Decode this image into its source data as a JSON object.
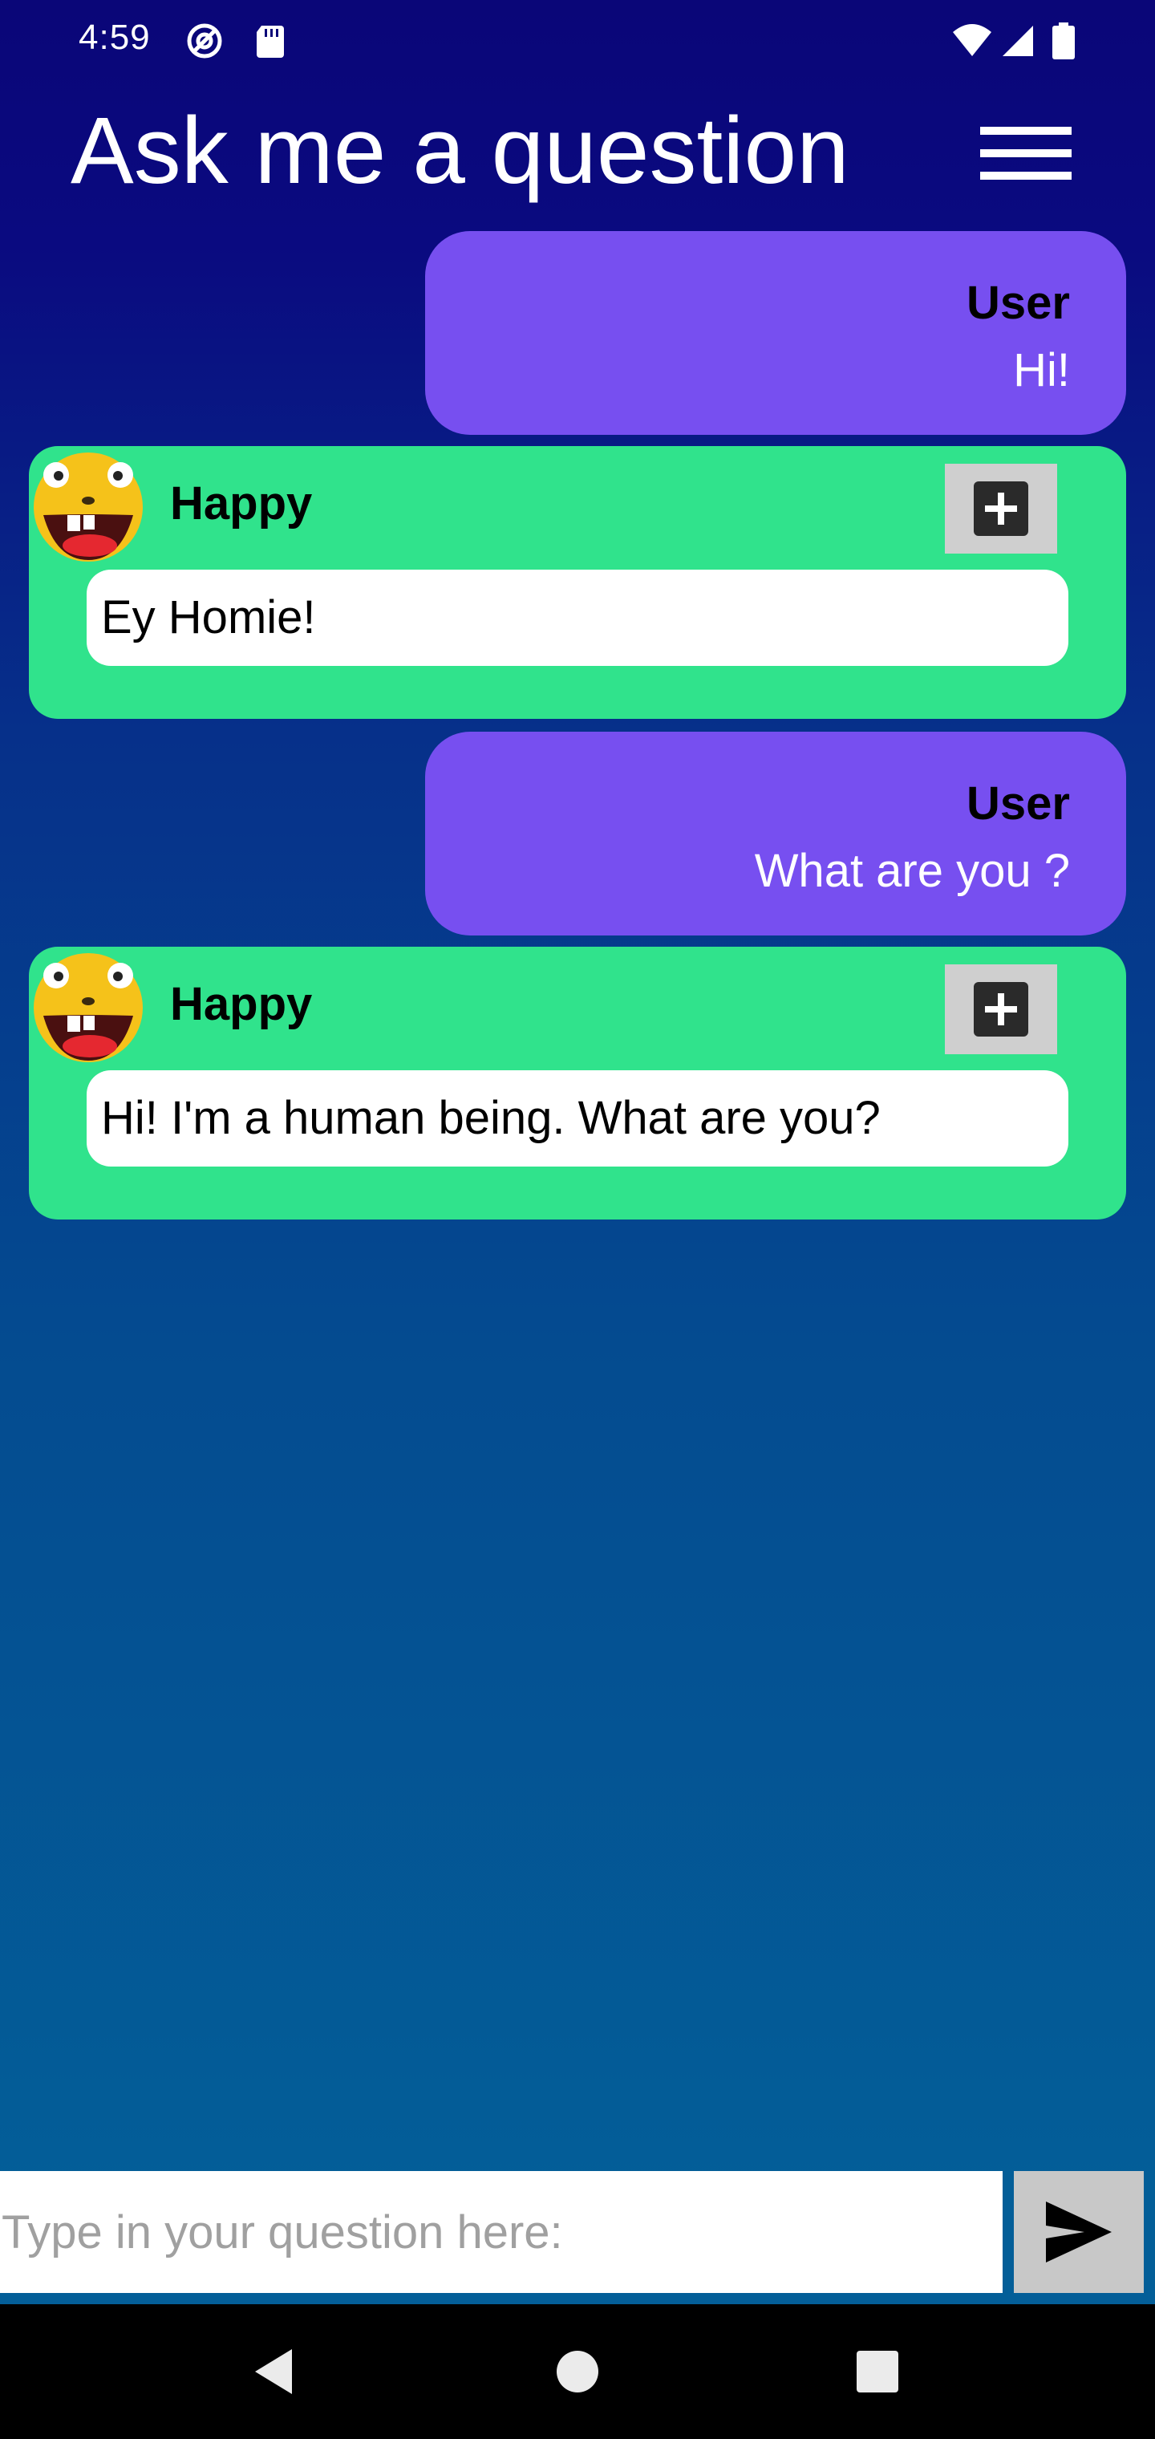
{
  "status_bar": {
    "time": "4:59",
    "icons": [
      "at-sign-icon",
      "sd-card-icon",
      "wifi-icon",
      "cellular-signal-icon",
      "battery-icon"
    ]
  },
  "header": {
    "title": "Ask me a question",
    "menu_icon": "hamburger-menu-icon"
  },
  "messages": [
    {
      "type": "user",
      "sender": "User",
      "text": "Hi!"
    },
    {
      "type": "bot",
      "sender": "Happy",
      "avatar": "happy-face-avatar",
      "action_icon": "add-box-icon",
      "text": "Ey Homie!"
    },
    {
      "type": "user",
      "sender": "User",
      "text": "What are you ?"
    },
    {
      "type": "bot",
      "sender": "Happy",
      "avatar": "happy-face-avatar",
      "action_icon": "add-box-icon",
      "text": "Hi! I'm a human being. What are you?"
    }
  ],
  "input": {
    "placeholder": "Type in your question here:",
    "value": "",
    "send_icon": "send-icon"
  },
  "nav": {
    "icons": [
      "back-icon",
      "home-icon",
      "recents-icon"
    ]
  },
  "colors": {
    "user_bubble": "#774ff0",
    "bot_card": "#30e38c",
    "background_top": "#0a0678",
    "background_bottom": "#035e98"
  }
}
